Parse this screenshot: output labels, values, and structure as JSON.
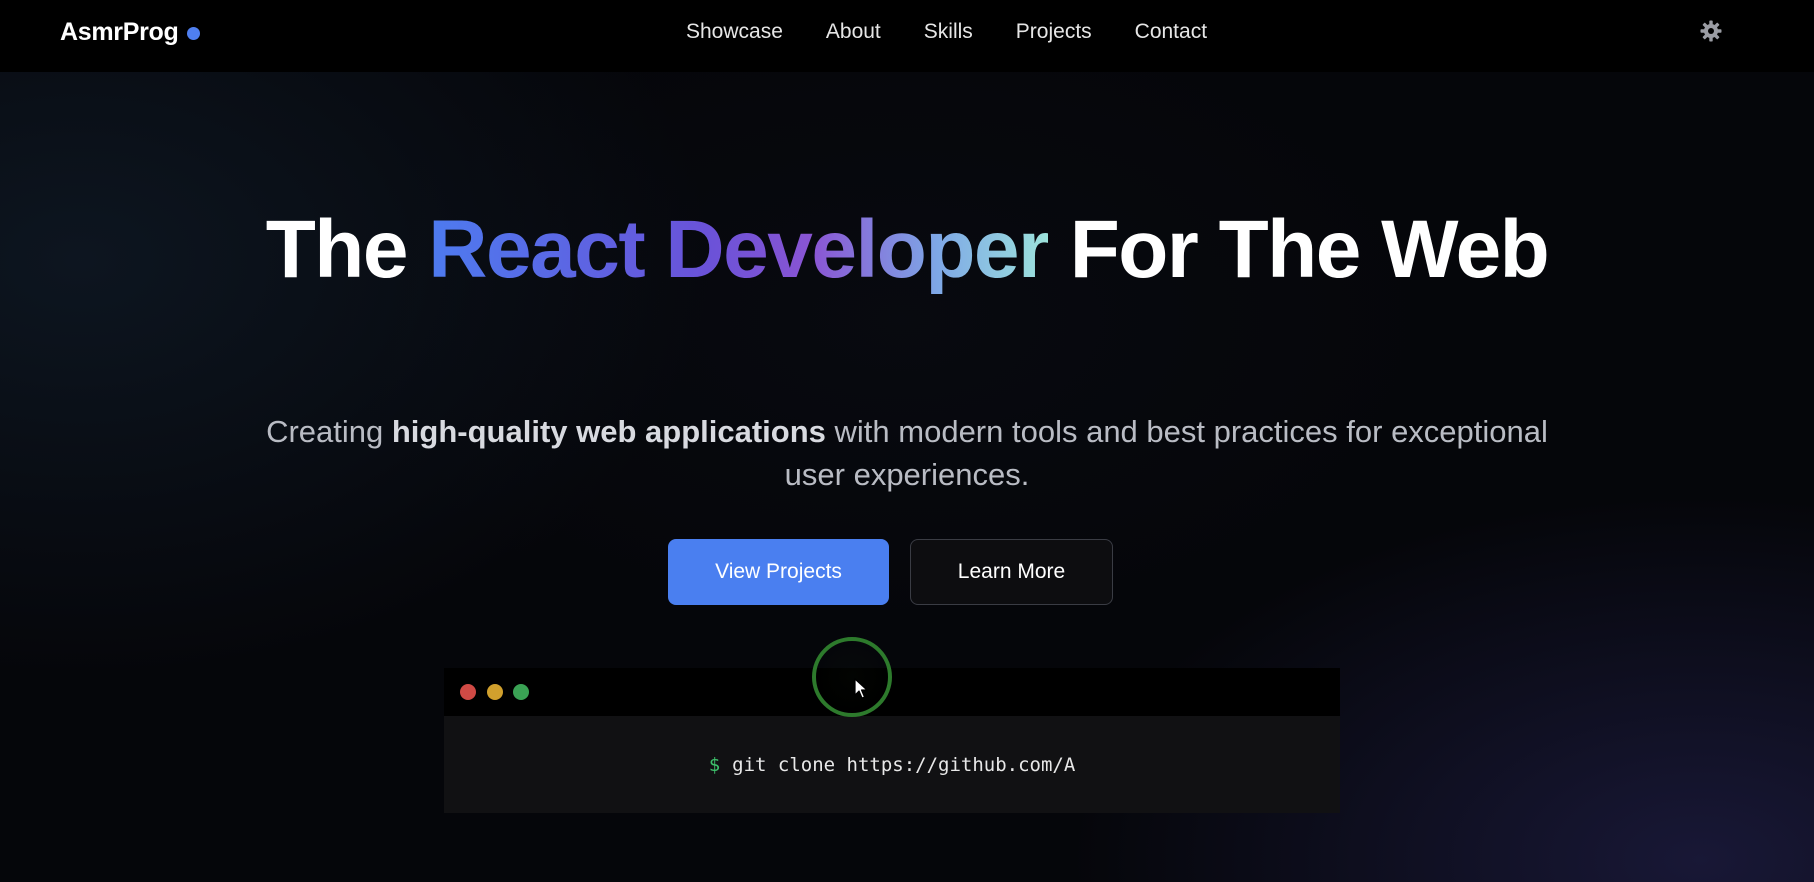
{
  "header": {
    "logo_text": "AsmrProg",
    "logo_dot_color": "#4f7ff0",
    "nav": [
      {
        "label": "Showcase"
      },
      {
        "label": "About"
      },
      {
        "label": "Skills"
      },
      {
        "label": "Projects"
      },
      {
        "label": "Contact"
      }
    ],
    "theme_toggle_icon": "gear-icon"
  },
  "hero": {
    "title_pre": "The ",
    "title_highlight": "React Developer",
    "title_post": " For The Web",
    "gradient_colors": [
      "#4d7bf0",
      "#6a52d8",
      "#8a55d3",
      "#9de3dc"
    ],
    "subtitle_pre": "Creating ",
    "subtitle_bold": "high-quality web applications",
    "subtitle_post": " with modern tools and best practices for exceptional user experiences.",
    "primary_button": "View Projects",
    "primary_color": "#4a7ff0",
    "secondary_button": "Learn More"
  },
  "terminal": {
    "window_dots": [
      "#d04a45",
      "#d1a02d",
      "#3aa254"
    ],
    "prompt": "$",
    "command": "git clone https://github.com/A"
  }
}
